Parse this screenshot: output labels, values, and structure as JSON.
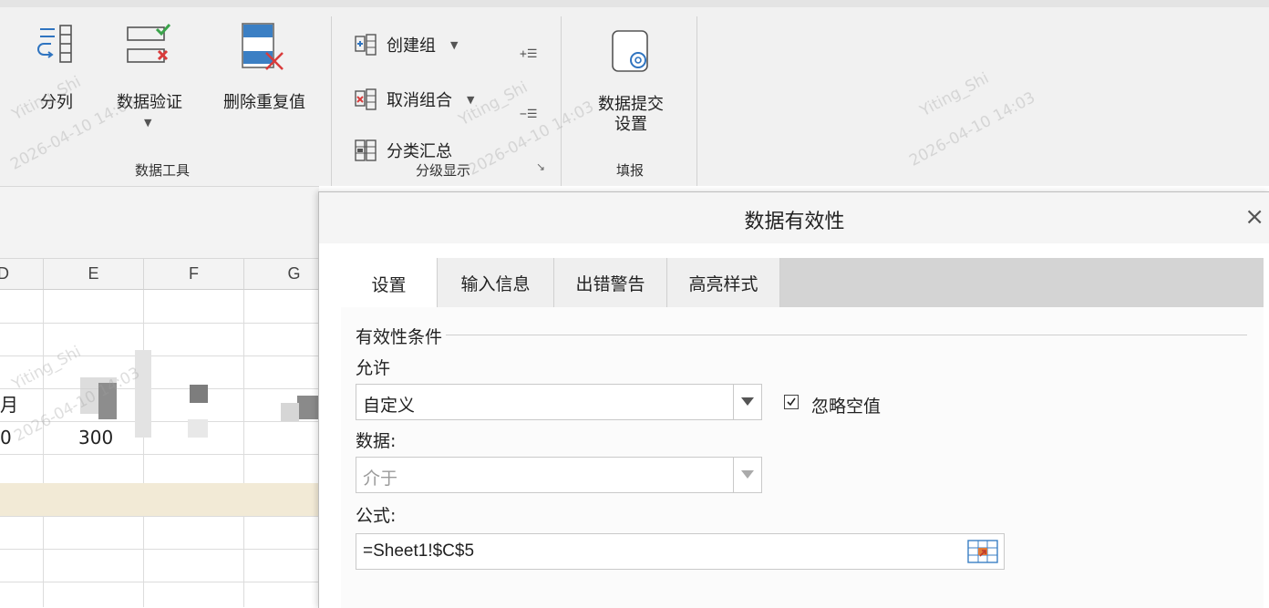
{
  "ribbon": {
    "data_tools": {
      "group_label": "数据工具",
      "split_label": "分列",
      "validate_label": "数据验证",
      "remove_dup_label": "删除重复值"
    },
    "outline": {
      "group_label": "分级显示",
      "create_group": "创建组",
      "ungroup": "取消组合",
      "subtotal": "分类汇总"
    },
    "fill_report": {
      "group_label": "填报",
      "submit_label": "数据提交设置"
    },
    "watermarks": [
      "Yiting_Shi",
      "2026-04-10 14:03"
    ]
  },
  "sheet": {
    "columns": [
      "D",
      "E",
      "F",
      "G"
    ],
    "partial_cells": [
      "月",
      "0",
      "300"
    ],
    "highlight_color": "#f2ead6"
  },
  "dialog": {
    "title": "数据有效性",
    "close_label": "×",
    "tabs": [
      "设置",
      "输入信息",
      "出错警告",
      "高亮样式"
    ],
    "active_tab": "设置",
    "section_title": "有效性条件",
    "allow_label": "允许",
    "allow_value": "自定义",
    "ignore_blank_label": "忽略空值",
    "ignore_blank_checked": true,
    "data_label": "数据:",
    "data_value": "介于",
    "formula_label": "公式:",
    "formula_value": "=Sheet1!$C$5"
  }
}
